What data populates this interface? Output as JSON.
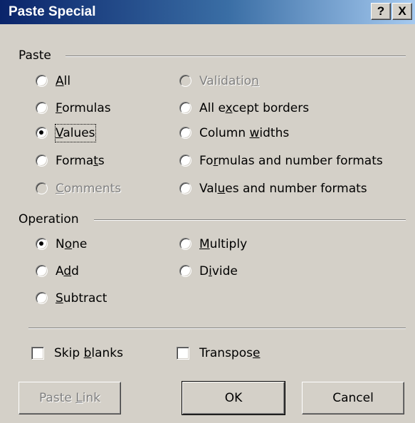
{
  "window": {
    "title": "Paste Special",
    "help_button": "?",
    "close_button": "X"
  },
  "paste_group": {
    "label": "Paste",
    "options": {
      "all": {
        "pre": "",
        "key": "A",
        "post": "ll",
        "checked": false,
        "disabled": false
      },
      "formulas": {
        "pre": "",
        "key": "F",
        "post": "ormulas",
        "checked": false,
        "disabled": false
      },
      "values": {
        "pre": "",
        "key": "V",
        "post": "alues",
        "checked": true,
        "disabled": false
      },
      "formats": {
        "pre": "Forma",
        "key": "t",
        "post": "s",
        "checked": false,
        "disabled": false
      },
      "comments": {
        "pre": "",
        "key": "C",
        "post": "omments",
        "checked": false,
        "disabled": true
      },
      "validation": {
        "pre": "Validatio",
        "key": "n",
        "post": "",
        "checked": false,
        "disabled": true
      },
      "all_except_borders": {
        "pre": "All e",
        "key": "x",
        "post": "cept borders",
        "checked": false,
        "disabled": false
      },
      "column_widths": {
        "pre": "Column ",
        "key": "w",
        "post": "idths",
        "checked": false,
        "disabled": false
      },
      "formulas_number_formats": {
        "pre": "Fo",
        "key": "r",
        "post": "mulas and number formats",
        "checked": false,
        "disabled": false
      },
      "values_number_formats": {
        "pre": "Val",
        "key": "u",
        "post": "es and number formats",
        "checked": false,
        "disabled": false
      }
    }
  },
  "operation_group": {
    "label": "Operation",
    "options": {
      "none": {
        "pre": "N",
        "key": "o",
        "post": "ne",
        "checked": true
      },
      "add": {
        "pre": "A",
        "key": "d",
        "post": "d",
        "checked": false
      },
      "subtract": {
        "pre": "",
        "key": "S",
        "post": "ubtract",
        "checked": false
      },
      "multiply": {
        "pre": "",
        "key": "M",
        "post": "ultiply",
        "checked": false
      },
      "divide": {
        "pre": "D",
        "key": "i",
        "post": "vide",
        "checked": false
      }
    }
  },
  "checkboxes": {
    "skip_blanks": {
      "pre": "Skip ",
      "key": "b",
      "post": "lanks",
      "checked": false
    },
    "transpose": {
      "pre": "Transpos",
      "key": "e",
      "post": "",
      "checked": false
    }
  },
  "buttons": {
    "paste_link": {
      "pre": "Paste ",
      "key": "L",
      "post": "ink",
      "disabled": true
    },
    "ok": "OK",
    "cancel": "Cancel"
  }
}
